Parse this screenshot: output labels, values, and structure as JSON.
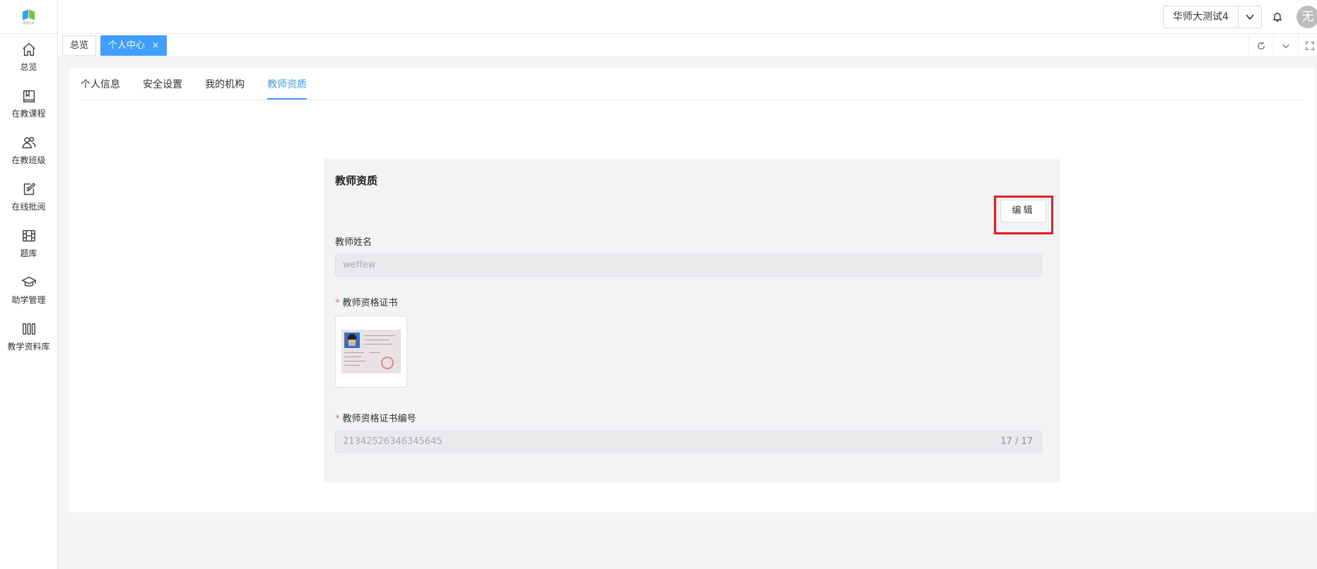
{
  "sidebar": {
    "logo_text": "慧思在线",
    "items": [
      {
        "label": "总览",
        "icon": "home-icon"
      },
      {
        "label": "在教课程",
        "icon": "book-icon"
      },
      {
        "label": "在教班级",
        "icon": "users-icon"
      },
      {
        "label": "在线批阅",
        "icon": "edit-icon"
      },
      {
        "label": "题库",
        "icon": "film-icon"
      },
      {
        "label": "助学管理",
        "icon": "graduation-cap-icon"
      },
      {
        "label": "教学资料库",
        "icon": "library-icon"
      }
    ]
  },
  "header": {
    "org_select": {
      "value": "华师大测试4"
    },
    "avatar_text": "无"
  },
  "tabs_bar": {
    "tags": [
      {
        "label": "总览",
        "active": false
      },
      {
        "label": "个人中心",
        "active": true,
        "close": "×"
      }
    ]
  },
  "page_tabs": [
    {
      "label": "个人信息",
      "active": false
    },
    {
      "label": "安全设置",
      "active": false
    },
    {
      "label": "我的机构",
      "active": false
    },
    {
      "label": "教师资质",
      "active": true
    }
  ],
  "panel": {
    "title": "教师资质",
    "edit_button": "编辑",
    "fields": {
      "name_label": "教师姓名",
      "name_value": "weffew",
      "cert_label": "教师资格证书",
      "cert_number_label": "教师资格证书编号",
      "cert_number_value": "21342526346345645",
      "cert_number_count": "17 / 17"
    },
    "required_mark": "*"
  },
  "colors": {
    "primary": "#409eff",
    "highlight": "#e02020",
    "required": "#f56c6c"
  }
}
